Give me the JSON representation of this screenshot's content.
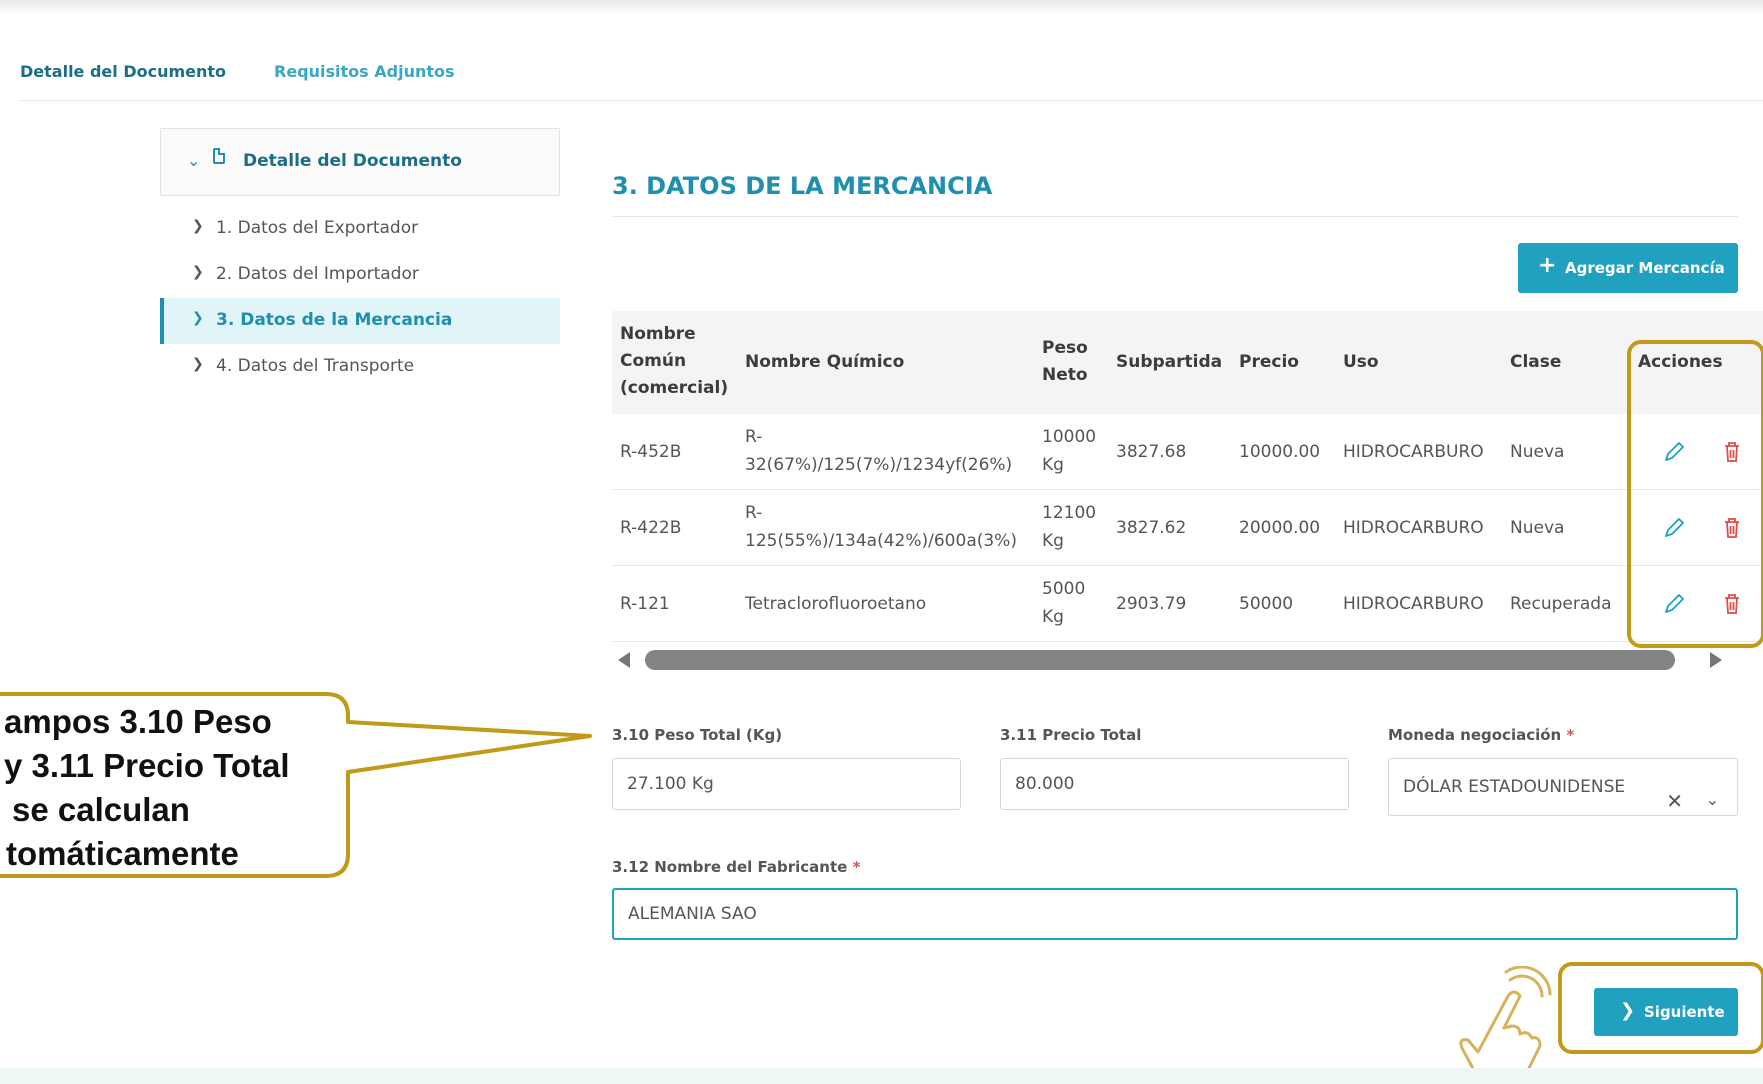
{
  "tabs": [
    {
      "label": "Detalle del Documento",
      "active": true
    },
    {
      "label": "Requisitos Adjuntos",
      "active": false
    }
  ],
  "sidebar": {
    "header": "Detalle del Documento",
    "items": [
      {
        "label": "1. Datos del Exportador",
        "active": false
      },
      {
        "label": "2. Datos del Importador",
        "active": false
      },
      {
        "label": "3. Datos de la Mercancia",
        "active": true
      },
      {
        "label": "4. Datos del Transporte",
        "active": false
      }
    ]
  },
  "section": {
    "title": "3. DATOS DE LA MERCANCIA",
    "add_button": "Agregar Mercancía"
  },
  "table": {
    "headers": {
      "nombre_comun": [
        "Nombre",
        "Común",
        "(comercial)"
      ],
      "nombre_quimico": "Nombre Químico",
      "peso_neto": [
        "Peso",
        "Neto"
      ],
      "subpartida": "Subpartida",
      "precio": "Precio",
      "uso": "Uso",
      "clase": "Clase",
      "acciones": "Acciones"
    },
    "rows": [
      {
        "nombre": "R-452B",
        "quimico": [
          "R-",
          "32(67%)/125(7%)/1234yf(26%)"
        ],
        "peso": [
          "10000",
          "Kg"
        ],
        "subpartida": "3827.68",
        "precio": "10000.00",
        "uso": "HIDROCARBURO",
        "clase": "Nueva"
      },
      {
        "nombre": "R-422B",
        "quimico": [
          "R-",
          "125(55%)/134a(42%)/600a(3%)"
        ],
        "peso": [
          "12100",
          "Kg"
        ],
        "subpartida": "3827.62",
        "precio": "20000.00",
        "uso": "HIDROCARBURO",
        "clase": "Nueva"
      },
      {
        "nombre": "R-121",
        "quimico": [
          "",
          "Tetraclorofluoroetano"
        ],
        "peso": [
          "5000",
          "Kg"
        ],
        "subpartida": "2903.79",
        "precio": "50000",
        "uso": "HIDROCARBURO",
        "clase": "Recuperada"
      }
    ]
  },
  "form": {
    "peso_total_label": "3.10 Peso Total (Kg)",
    "peso_total_value": "27.100 Kg",
    "precio_total_label": "3.11 Precio Total",
    "precio_total_value": "80.000",
    "moneda_label": "Moneda negociación",
    "moneda_value": "DÓLAR ESTADOUNIDENSE",
    "fabricante_label": "3.12 Nombre del Fabricante",
    "fabricante_value": "ALEMANIA SAO",
    "required_mark": "*"
  },
  "next_button": "Siguiente",
  "callout": {
    "lines": [
      "ampos 3.10 Peso",
      "y 3.11 Precio Total",
      "se calculan",
      "tomáticamente"
    ]
  },
  "colors": {
    "accent": "#1fa1bf",
    "dark_accent": "#1a6f87",
    "callout_gold": "#c09a18",
    "danger": "#e14b4b"
  },
  "icons": [
    "chevron-down-icon",
    "document-icon",
    "chevron-right-icon",
    "plus-icon",
    "pencil-icon",
    "trash-icon",
    "close-icon",
    "pointing-hand-icon"
  ]
}
